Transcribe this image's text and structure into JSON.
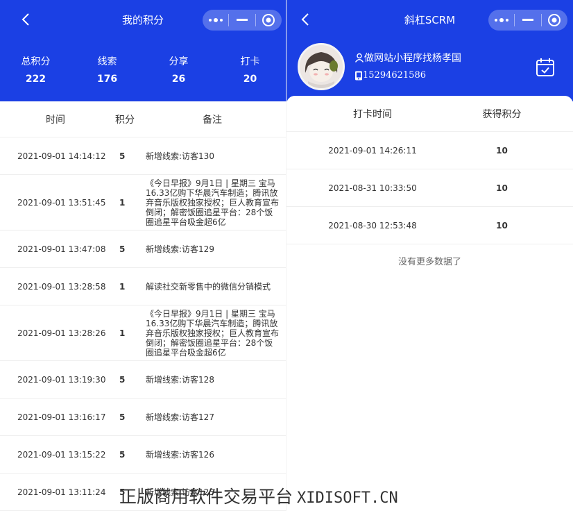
{
  "left": {
    "nav_title": "我的积分",
    "stats": [
      {
        "label": "总积分",
        "value": "222"
      },
      {
        "label": "线索",
        "value": "176"
      },
      {
        "label": "分享",
        "value": "26"
      },
      {
        "label": "打卡",
        "value": "20"
      }
    ],
    "columns": {
      "time": "时间",
      "score": "积分",
      "note": "备注"
    },
    "rows": [
      {
        "time": "2021-09-01 14:14:12",
        "score": "5",
        "note": "新增线索:访客130"
      },
      {
        "time": "2021-09-01 13:51:45",
        "score": "1",
        "note": "《今日早报》9月1日 | 星期三 宝马16.33亿购下华晨汽车制造；腾讯放弃音乐版权独家授权；巨人教育宣布倒闭；解密饭圈追星平台：28个饭圈追星平台吸金超6亿"
      },
      {
        "time": "2021-09-01 13:47:08",
        "score": "5",
        "note": "新增线索:访客129"
      },
      {
        "time": "2021-09-01 13:28:58",
        "score": "1",
        "note": "解读社交新零售中的微信分销模式"
      },
      {
        "time": "2021-09-01 13:28:26",
        "score": "1",
        "note": "《今日早报》9月1日 | 星期三 宝马16.33亿购下华晨汽车制造；腾讯放弃音乐版权独家授权；巨人教育宣布倒闭；解密饭圈追星平台：28个饭圈追星平台吸金超6亿"
      },
      {
        "time": "2021-09-01 13:19:30",
        "score": "5",
        "note": "新增线索:访客128"
      },
      {
        "time": "2021-09-01 13:16:17",
        "score": "5",
        "note": "新增线索:访客127"
      },
      {
        "time": "2021-09-01 13:15:22",
        "score": "5",
        "note": "新增线索:访客126"
      },
      {
        "time": "2021-09-01 13:11:24",
        "score": "5",
        "note": "新增线索:访客125"
      }
    ]
  },
  "right": {
    "nav_title": "斜杠SCRM",
    "profile": {
      "name": "做网站小程序找杨孝国",
      "phone": "15294621586"
    },
    "columns": {
      "time": "打卡时间",
      "score": "获得积分"
    },
    "rows": [
      {
        "time": "2021-09-01 14:26:11",
        "score": "10"
      },
      {
        "time": "2021-08-31 10:33:50",
        "score": "10"
      },
      {
        "time": "2021-08-30 12:53:48",
        "score": "10"
      }
    ],
    "no_more": "没有更多数据了"
  },
  "watermark": {
    "cn": "正版商用软件交易平台",
    "en": "XIDISOFT.CN"
  },
  "colors": {
    "brand": "#1b40e4",
    "background": "#ffffff",
    "text": "#333333"
  },
  "icons": [
    "back-arrow-icon",
    "more-dots-icon",
    "minimize-icon",
    "close-target-icon",
    "user-icon",
    "phone-icon",
    "calendar-check-icon"
  ]
}
